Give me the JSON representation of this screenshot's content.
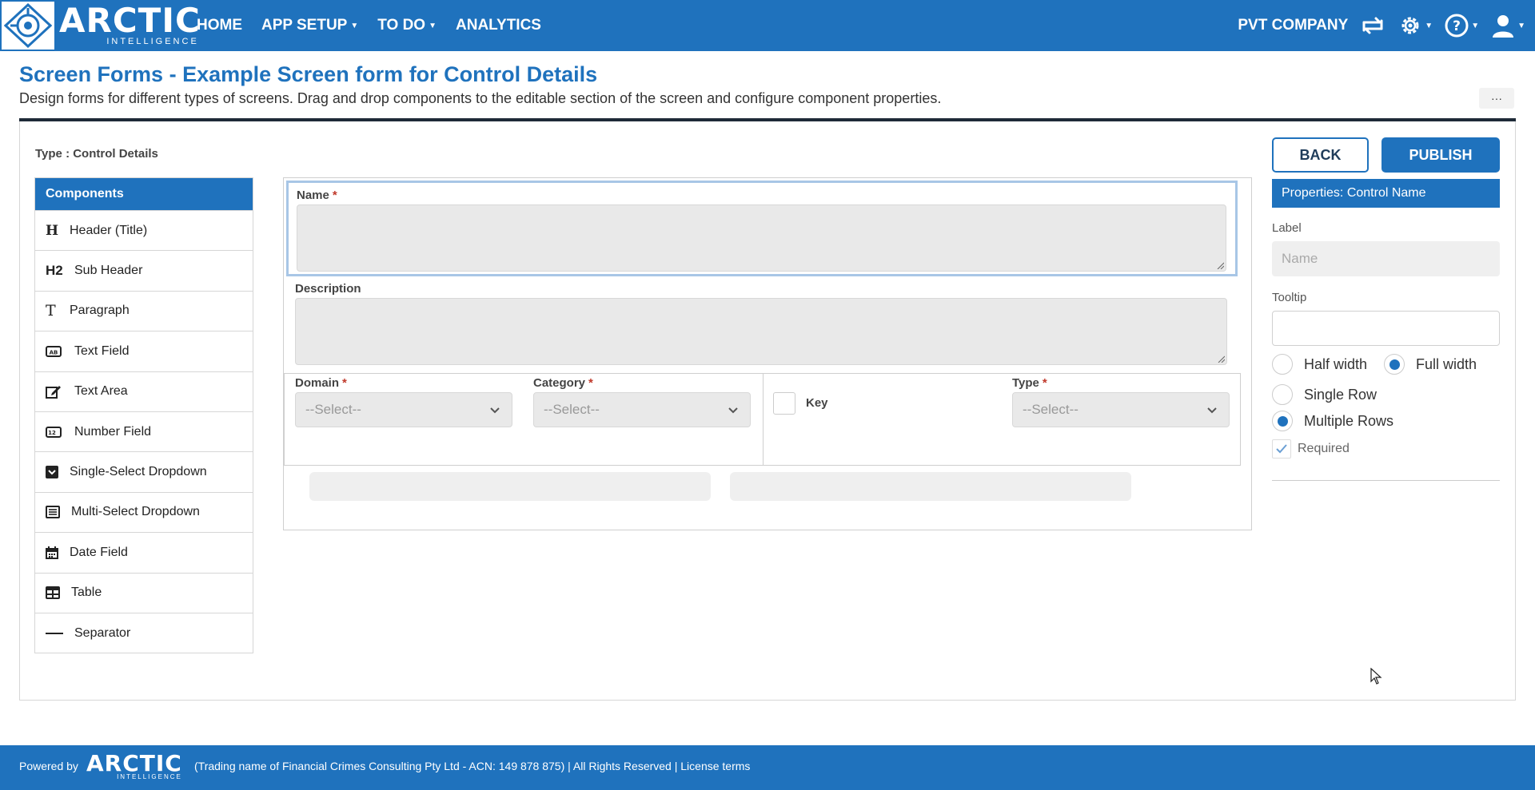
{
  "brand": {
    "name": "ARCTIC",
    "tagline": "INTELLIGENCE"
  },
  "nav": {
    "items": [
      {
        "label": "HOME",
        "has_caret": false
      },
      {
        "label": "APP SETUP",
        "has_caret": true
      },
      {
        "label": "TO DO",
        "has_caret": true
      },
      {
        "label": "ANALYTICS",
        "has_caret": false
      }
    ],
    "company": "PVT COMPANY"
  },
  "page": {
    "title": "Screen Forms - Example Screen form for Control Details",
    "description": "Design forms for different types of screens. Drag and drop components to the editable section of the screen and configure component properties.",
    "more_label": "···",
    "type_label": "Type : Control Details"
  },
  "components": {
    "header": "Components",
    "items": [
      {
        "icon": "H",
        "label": "Header (Title)",
        "name": "header-title"
      },
      {
        "icon": "H2",
        "label": "Sub Header",
        "name": "sub-header"
      },
      {
        "icon": "T",
        "label": "Paragraph",
        "name": "paragraph"
      },
      {
        "icon": "text-field-icon",
        "label": "Text Field",
        "name": "text-field"
      },
      {
        "icon": "text-area-icon",
        "label": "Text Area",
        "name": "text-area"
      },
      {
        "icon": "number-field-icon",
        "label": "Number Field",
        "name": "number-field"
      },
      {
        "icon": "single-select-icon",
        "label": "Single-Select Dropdown",
        "name": "single-select-dropdown"
      },
      {
        "icon": "multi-select-icon",
        "label": "Multi-Select Dropdown",
        "name": "multi-select-dropdown"
      },
      {
        "icon": "calendar-icon",
        "label": "Date Field",
        "name": "date-field"
      },
      {
        "icon": "table-icon",
        "label": "Table",
        "name": "table"
      },
      {
        "icon": "separator-icon",
        "label": "Separator",
        "name": "separator"
      }
    ]
  },
  "canvas": {
    "name_label": "Name",
    "description_label": "Description",
    "domain_label": "Domain",
    "domain_placeholder": "--Select--",
    "category_label": "Category",
    "category_placeholder": "--Select--",
    "key_label": "Key",
    "type_label": "Type",
    "type_placeholder": "--Select--",
    "required_mark": "*"
  },
  "properties": {
    "back_label": "BACK",
    "publish_label": "PUBLISH",
    "header": "Properties: Control Name",
    "label_label": "Label",
    "label_placeholder": "Name",
    "tooltip_label": "Tooltip",
    "tooltip_value": "",
    "width_options": [
      {
        "label": "Half width",
        "selected": false
      },
      {
        "label": "Full width",
        "selected": true
      }
    ],
    "row_options": [
      {
        "label": "Single Row",
        "selected": false
      },
      {
        "label": "Multiple Rows",
        "selected": true
      }
    ],
    "required_label": "Required",
    "required_checked": true
  },
  "footer": {
    "powered_by": "Powered by",
    "logo_main": "ARCTIC",
    "logo_sub": "INTELLIGENCE",
    "text": "(Trading name of Financial Crimes Consulting Pty Ltd - ACN: 149 878 875)  | All Rights Reserved  | License terms"
  },
  "colors": {
    "primary": "#1f72bd",
    "required": "#c0392b"
  }
}
